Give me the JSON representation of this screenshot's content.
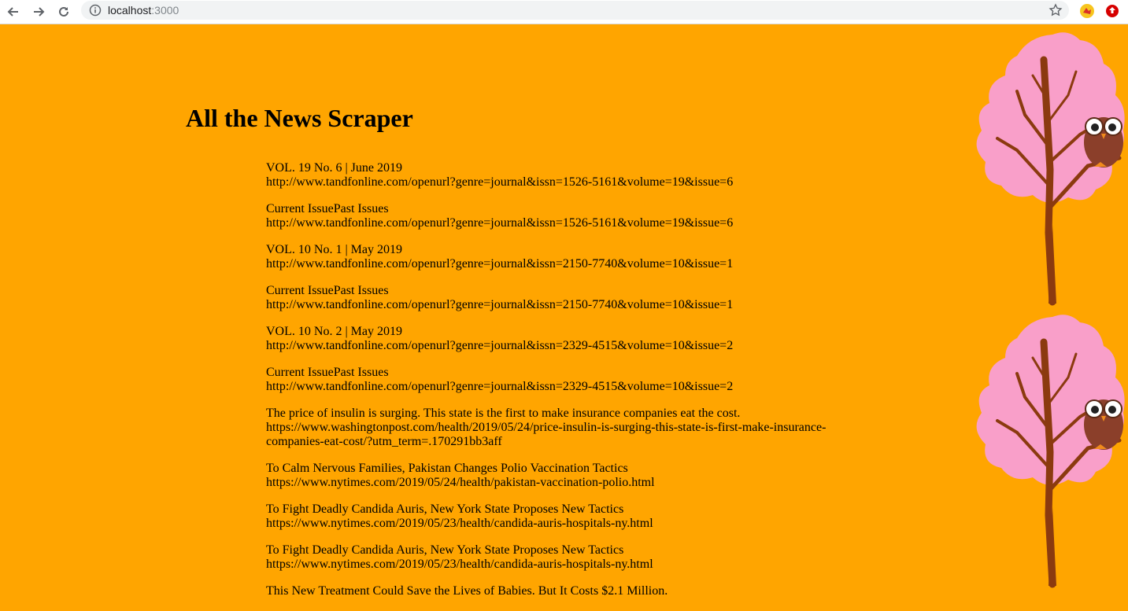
{
  "browser": {
    "url_host": "localhost",
    "url_port": ":3000"
  },
  "page": {
    "title": "All the News Scraper"
  },
  "articles": [
    {
      "headline": "VOL. 19 No. 6 | June 2019",
      "link": "http://www.tandfonline.com/openurl?genre=journal&issn=1526-5161&volume=19&issue=6"
    },
    {
      "headline": "Current IssuePast Issues",
      "link": "http://www.tandfonline.com/openurl?genre=journal&issn=1526-5161&volume=19&issue=6"
    },
    {
      "headline": "VOL. 10 No. 1 | May 2019",
      "link": "http://www.tandfonline.com/openurl?genre=journal&issn=2150-7740&volume=10&issue=1"
    },
    {
      "headline": "Current IssuePast Issues",
      "link": "http://www.tandfonline.com/openurl?genre=journal&issn=2150-7740&volume=10&issue=1"
    },
    {
      "headline": "VOL. 10 No. 2 | May 2019",
      "link": "http://www.tandfonline.com/openurl?genre=journal&issn=2329-4515&volume=10&issue=2"
    },
    {
      "headline": "Current IssuePast Issues",
      "link": "http://www.tandfonline.com/openurl?genre=journal&issn=2329-4515&volume=10&issue=2"
    },
    {
      "headline": "The price of insulin is surging. This state is the first to make insurance companies eat the cost.",
      "link": "https://www.washingtonpost.com/health/2019/05/24/price-insulin-is-surging-this-state-is-first-make-insurance-companies-eat-cost/?utm_term=.170291bb3aff"
    },
    {
      "headline": "To Calm Nervous Families, Pakistan Changes Polio Vaccination Tactics",
      "link": "https://www.nytimes.com/2019/05/24/health/pakistan-vaccination-polio.html"
    },
    {
      "headline": "To Fight Deadly Candida Auris, New York State Proposes New Tactics",
      "link": "https://www.nytimes.com/2019/05/23/health/candida-auris-hospitals-ny.html"
    },
    {
      "headline": "To Fight Deadly Candida Auris, New York State Proposes New Tactics",
      "link": "https://www.nytimes.com/2019/05/23/health/candida-auris-hospitals-ny.html"
    },
    {
      "headline": "This New Treatment Could Save the Lives of Babies. But It Costs $2.1 Million.",
      "link": ""
    }
  ],
  "colors": {
    "page_background": "#ffa500",
    "tree_foliage": "#f99fc9",
    "tree_trunk": "#8b3a0f",
    "owl_body": "#8b3f2a"
  },
  "icons": {
    "back": "arrow-left",
    "forward": "arrow-right",
    "reload": "reload",
    "info": "info-circle",
    "bookmark": "star",
    "extension1": "puzzle-extension",
    "extension2": "upload-extension"
  }
}
